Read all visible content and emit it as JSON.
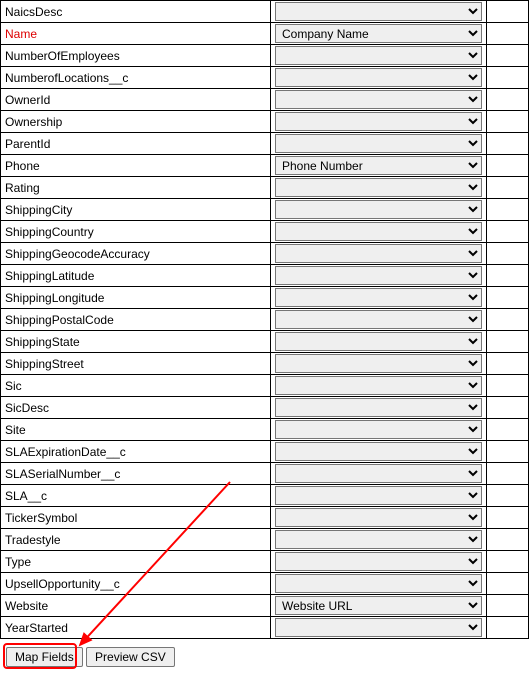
{
  "rows": [
    {
      "label": "NaicsDesc",
      "value": "",
      "required": false
    },
    {
      "label": "Name",
      "value": "Company Name",
      "required": true
    },
    {
      "label": "NumberOfEmployees",
      "value": "",
      "required": false
    },
    {
      "label": "NumberofLocations__c",
      "value": "",
      "required": false
    },
    {
      "label": "OwnerId",
      "value": "",
      "required": false
    },
    {
      "label": "Ownership",
      "value": "",
      "required": false
    },
    {
      "label": "ParentId",
      "value": "",
      "required": false
    },
    {
      "label": "Phone",
      "value": "Phone Number",
      "required": false
    },
    {
      "label": "Rating",
      "value": "",
      "required": false
    },
    {
      "label": "ShippingCity",
      "value": "",
      "required": false
    },
    {
      "label": "ShippingCountry",
      "value": "",
      "required": false
    },
    {
      "label": "ShippingGeocodeAccuracy",
      "value": "",
      "required": false
    },
    {
      "label": "ShippingLatitude",
      "value": "",
      "required": false
    },
    {
      "label": "ShippingLongitude",
      "value": "",
      "required": false
    },
    {
      "label": "ShippingPostalCode",
      "value": "",
      "required": false
    },
    {
      "label": "ShippingState",
      "value": "",
      "required": false
    },
    {
      "label": "ShippingStreet",
      "value": "",
      "required": false
    },
    {
      "label": "Sic",
      "value": "",
      "required": false
    },
    {
      "label": "SicDesc",
      "value": "",
      "required": false
    },
    {
      "label": "Site",
      "value": "",
      "required": false
    },
    {
      "label": "SLAExpirationDate__c",
      "value": "",
      "required": false
    },
    {
      "label": "SLASerialNumber__c",
      "value": "",
      "required": false
    },
    {
      "label": "SLA__c",
      "value": "",
      "required": false
    },
    {
      "label": "TickerSymbol",
      "value": "",
      "required": false
    },
    {
      "label": "Tradestyle",
      "value": "",
      "required": false
    },
    {
      "label": "Type",
      "value": "",
      "required": false
    },
    {
      "label": "UpsellOpportunity__c",
      "value": "",
      "required": false
    },
    {
      "label": "Website",
      "value": "Website URL",
      "required": false
    },
    {
      "label": "YearStarted",
      "value": "",
      "required": false
    }
  ],
  "buttons": {
    "map": "Map Fields",
    "preview": "Preview CSV"
  },
  "mapping_options": [
    "",
    "Company Name",
    "Phone Number",
    "Website URL"
  ]
}
